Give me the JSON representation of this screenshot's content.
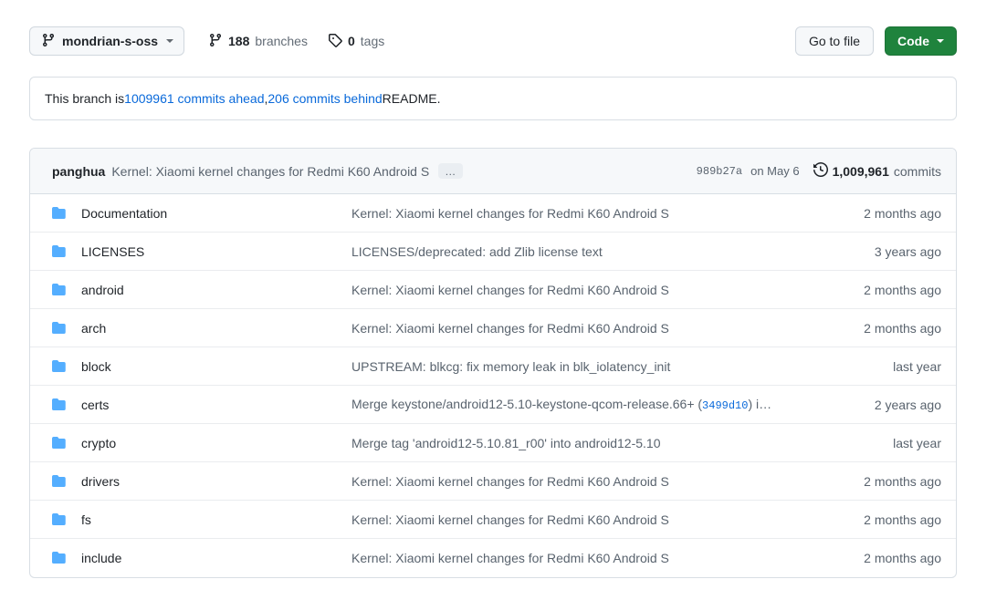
{
  "toolbar": {
    "branch_name": "mondrian-s-oss",
    "branches_count": "188",
    "branches_label": "branches",
    "tags_count": "0",
    "tags_label": "tags",
    "go_to_file_label": "Go to file",
    "code_label": "Code"
  },
  "status_banner": {
    "prefix": "This branch is ",
    "ahead_link": "1009961 commits ahead",
    "separator": ", ",
    "behind_link": "206 commits behind",
    "suffix": " README."
  },
  "latest_commit": {
    "author": "panghua",
    "message": "Kernel: Xiaomi kernel changes for Redmi K60 Android S",
    "expand_label": "…",
    "sha": "989b27a",
    "date": "on May 6",
    "commits_count": "1,009,961",
    "commits_label": "commits"
  },
  "files": [
    {
      "icon": "folder-icon",
      "name": "Documentation",
      "message": "Kernel: Xiaomi kernel changes for Redmi K60 Android S",
      "message_sha": "",
      "message_tail": "",
      "time": "2 months ago"
    },
    {
      "icon": "folder-icon",
      "name": "LICENSES",
      "message": "LICENSES/deprecated: add Zlib license text",
      "message_sha": "",
      "message_tail": "",
      "time": "3 years ago"
    },
    {
      "icon": "folder-icon",
      "name": "android",
      "message": "Kernel: Xiaomi kernel changes for Redmi K60 Android S",
      "message_sha": "",
      "message_tail": "",
      "time": "2 months ago"
    },
    {
      "icon": "folder-icon",
      "name": "arch",
      "message": "Kernel: Xiaomi kernel changes for Redmi K60 Android S",
      "message_sha": "",
      "message_tail": "",
      "time": "2 months ago"
    },
    {
      "icon": "folder-icon",
      "name": "block",
      "message": "UPSTREAM: blkcg: fix memory leak in blk_iolatency_init",
      "message_sha": "",
      "message_tail": "",
      "time": "last year"
    },
    {
      "icon": "folder-icon",
      "name": "certs",
      "message": "Merge keystone/android12-5.10-keystone-qcom-release.66+ (",
      "message_sha": "3499d10",
      "message_tail": ") i…",
      "time": "2 years ago"
    },
    {
      "icon": "folder-icon",
      "name": "crypto",
      "message": "Merge tag 'android12-5.10.81_r00' into android12-5.10",
      "message_sha": "",
      "message_tail": "",
      "time": "last year"
    },
    {
      "icon": "folder-icon",
      "name": "drivers",
      "message": "Kernel: Xiaomi kernel changes for Redmi K60 Android S",
      "message_sha": "",
      "message_tail": "",
      "time": "2 months ago"
    },
    {
      "icon": "folder-icon",
      "name": "fs",
      "message": "Kernel: Xiaomi kernel changes for Redmi K60 Android S",
      "message_sha": "",
      "message_tail": "",
      "time": "2 months ago"
    },
    {
      "icon": "folder-icon",
      "name": "include",
      "message": "Kernel: Xiaomi kernel changes for Redmi K60 Android S",
      "message_sha": "",
      "message_tail": "",
      "time": "2 months ago"
    }
  ],
  "colors": {
    "accent_blue": "#0969da",
    "code_green": "#1f833d",
    "folder_blue": "#54aeff",
    "muted_text": "#59636e",
    "border": "#d8dee4",
    "header_bg": "#f6f8fa"
  }
}
